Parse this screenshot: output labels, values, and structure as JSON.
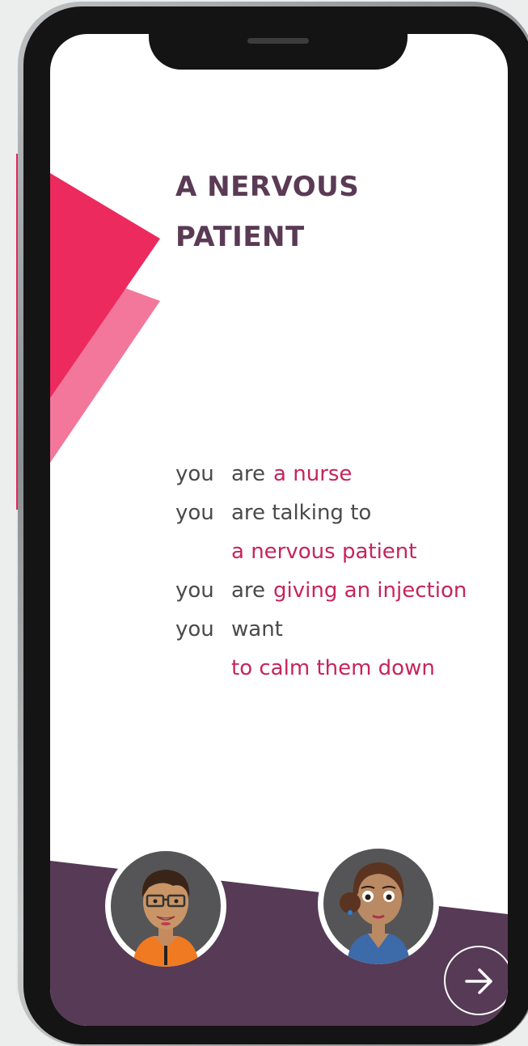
{
  "scenario_title": {
    "line1": "A NERVOUS",
    "line2": "PATIENT"
  },
  "scenario": {
    "lines": [
      {
        "you": "you",
        "verb": "are",
        "highlight": "a nurse"
      },
      {
        "you": "you",
        "verb": "are talking to",
        "highlight": ""
      },
      {
        "continuation": "a nervous patient"
      },
      {
        "you": "you",
        "verb": "are",
        "highlight": "giving an injection"
      },
      {
        "you": "you",
        "verb": "want",
        "highlight": ""
      },
      {
        "continuation": "to calm them down"
      }
    ]
  },
  "characters": {
    "nurse": "male-nurse-avatar",
    "patient": "female-patient-avatar"
  },
  "colors": {
    "title": "#5a3a55",
    "accent": "#c7245a",
    "pink_triangle": "#ec2a5e",
    "light_pink_triangle": "#f3779b",
    "bottom_band": "#573a55"
  },
  "icons": {
    "next": "arrow-right-icon"
  }
}
